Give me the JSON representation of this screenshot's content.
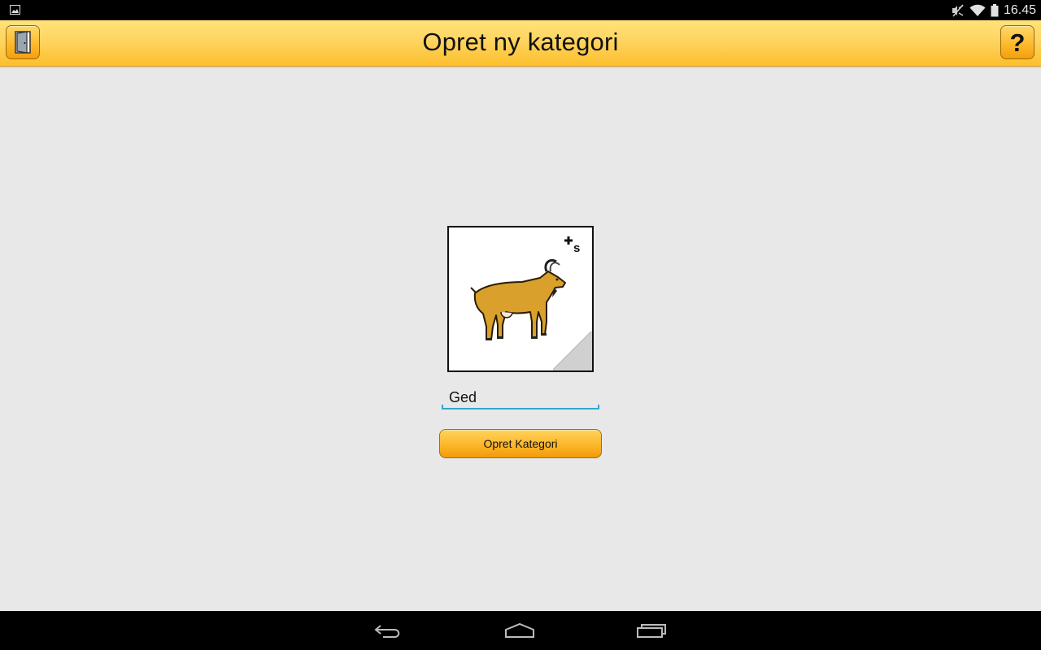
{
  "status_bar": {
    "time": "16.45",
    "icons": [
      "image-notification-icon",
      "mute-icon",
      "wifi-icon",
      "battery-icon"
    ]
  },
  "action_bar": {
    "title": "Opret ny kategori",
    "left_button_icon": "exit-door-icon",
    "right_button_label": "?"
  },
  "content": {
    "picture": {
      "subject": "goat-icon",
      "badge_icon": "plus-s-icon"
    },
    "name_field": {
      "value": "Ged",
      "placeholder": ""
    },
    "create_button_label": "Opret Kategori"
  },
  "nav_bar": {
    "buttons": [
      "back-icon",
      "home-icon",
      "recent-apps-icon"
    ]
  },
  "colors": {
    "accent": "#fcbf2c",
    "field_underline": "#33a6cf",
    "background": "#e8e8e8"
  }
}
